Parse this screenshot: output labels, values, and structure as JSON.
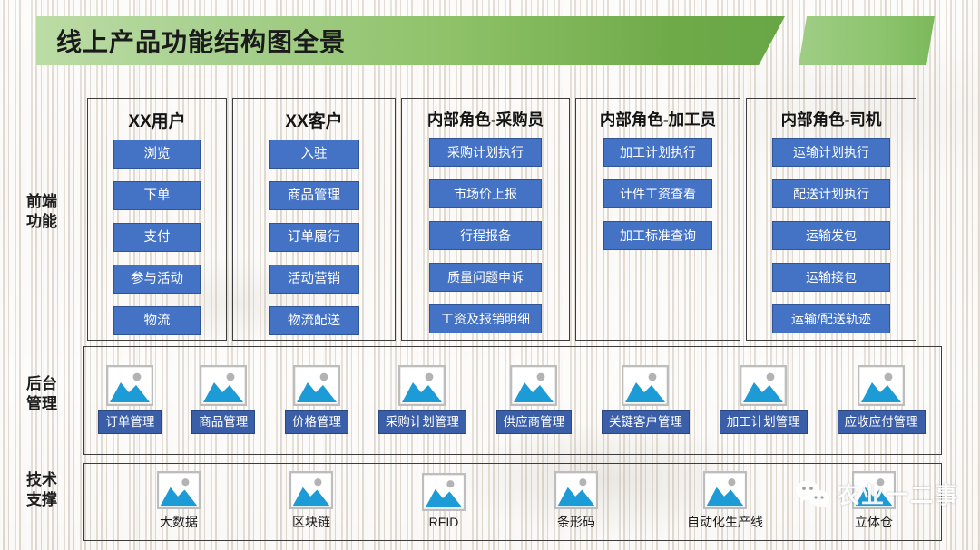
{
  "header": {
    "title": "线上产品功能结构图全景",
    "band_color_start": "#bcdca6",
    "band_color_end": "#68a645",
    "accent_color": "#8dc46e"
  },
  "rail": {
    "frontend": "前端\n功能",
    "frontend_line1": "前端",
    "frontend_line2": "功能",
    "backend_line1": "后台",
    "backend_line2": "管理",
    "tech_line1": "技术",
    "tech_line2": "支撑"
  },
  "colors": {
    "button_blue": "#4472c4",
    "backend_label_blue": "#3b5ea8",
    "icon_blue": "#1d9bd7",
    "border_gray": "#3d3d3d"
  },
  "frontend": {
    "columns": [
      {
        "title": "XX用户",
        "items": [
          "浏览",
          "下单",
          "支付",
          "参与活动",
          "物流"
        ]
      },
      {
        "title": "XX客户",
        "items": [
          "入驻",
          "商品管理",
          "订单履行",
          "活动营销",
          "物流配送"
        ]
      },
      {
        "title": "内部角色-采购员",
        "items": [
          "采购计划执行",
          "市场价上报",
          "行程报备",
          "质量问题申诉",
          "工资及报销明细"
        ]
      },
      {
        "title": "内部角色-加工员",
        "items": [
          "加工计划执行",
          "计件工资查看",
          "加工标准查询"
        ]
      },
      {
        "title": "内部角色-司机",
        "items": [
          "运输计划执行",
          "配送计划执行",
          "运输发包",
          "运输接包",
          "运输/配送轨迹"
        ]
      }
    ]
  },
  "backend": {
    "items": [
      {
        "label": "订单管理",
        "icon": "image-placeholder-icon"
      },
      {
        "label": "商品管理",
        "icon": "image-placeholder-icon"
      },
      {
        "label": "价格管理",
        "icon": "image-placeholder-icon"
      },
      {
        "label": "采购计划管理",
        "icon": "image-placeholder-icon"
      },
      {
        "label": "供应商管理",
        "icon": "image-placeholder-icon"
      },
      {
        "label": "关键客户管理",
        "icon": "image-placeholder-icon"
      },
      {
        "label": "加工计划管理",
        "icon": "image-placeholder-icon"
      },
      {
        "label": "应收应付管理",
        "icon": "image-placeholder-icon"
      }
    ]
  },
  "tech": {
    "items": [
      {
        "label": "大数据",
        "icon": "image-placeholder-icon"
      },
      {
        "label": "区块链",
        "icon": "image-placeholder-icon"
      },
      {
        "label": "RFID",
        "icon": "image-placeholder-icon"
      },
      {
        "label": "条形码",
        "icon": "image-placeholder-icon"
      },
      {
        "label": "自动化生产线",
        "icon": "image-placeholder-icon"
      },
      {
        "label": "立体仓",
        "icon": "image-placeholder-icon"
      }
    ]
  },
  "watermark": {
    "text": "农业一二事",
    "icon": "wechat-icon"
  }
}
